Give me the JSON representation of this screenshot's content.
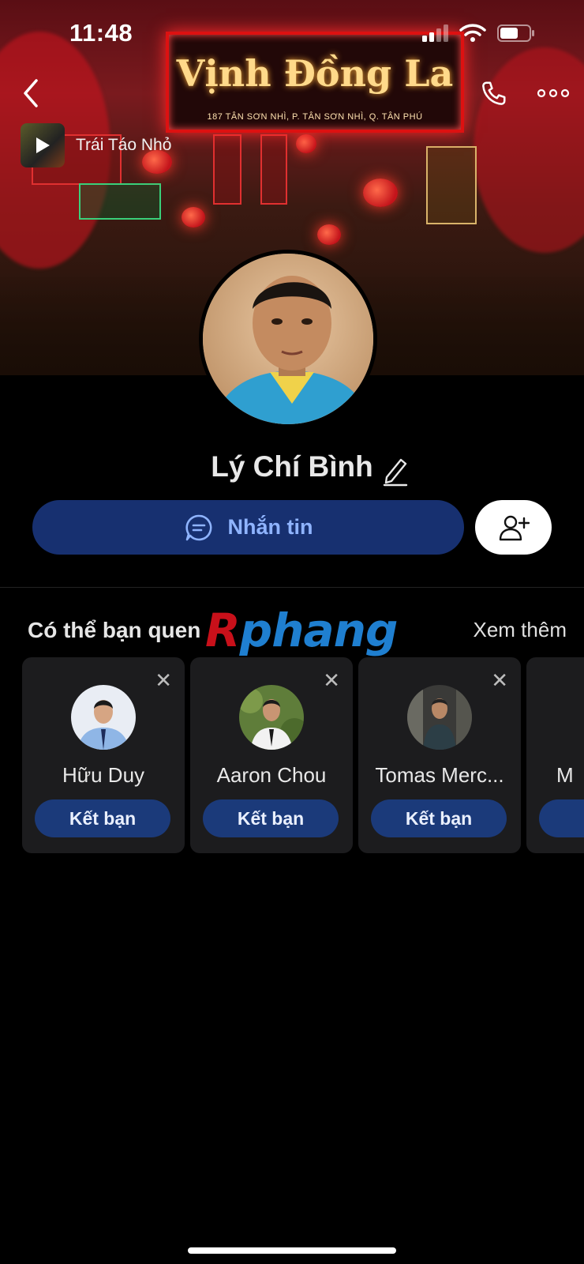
{
  "status_bar": {
    "time": "11:48"
  },
  "cover": {
    "sign_title": "Vịnh Đồng La",
    "sign_subtitle": "187 TÂN SƠN NHÌ, P. TÂN SƠN NHÌ, Q. TÂN PHÚ"
  },
  "music": {
    "title": "Trái Táo Nhỏ"
  },
  "profile": {
    "name": "Lý Chí Bình"
  },
  "actions": {
    "message_label": "Nhắn tin"
  },
  "suggestions": {
    "title": "Có thể bạn quen",
    "see_more": "Xem thêm",
    "watermark_parts": [
      "R",
      "phang"
    ],
    "items": [
      {
        "name": "Hữu Duy",
        "button": "Kết bạn"
      },
      {
        "name": "Aaron Chou",
        "button": "Kết bạn"
      },
      {
        "name": "Tomas Merc...",
        "button": "Kết bạn"
      },
      {
        "name": "M",
        "button": ""
      }
    ]
  },
  "colors": {
    "primary_button_bg": "#173070",
    "primary_button_text": "#8fb4ff",
    "card_bg": "#1c1c1e",
    "card_button_bg": "#1b3a7a"
  }
}
